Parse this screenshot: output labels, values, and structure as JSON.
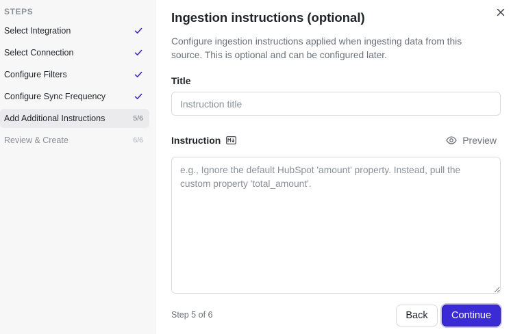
{
  "sidebar": {
    "heading": "STEPS",
    "steps": [
      {
        "label": "Select Integration",
        "status": "complete",
        "icon": "check-icon"
      },
      {
        "label": "Select Connection",
        "status": "complete",
        "icon": "check-icon"
      },
      {
        "label": "Configure Filters",
        "status": "complete",
        "icon": "check-icon"
      },
      {
        "label": "Configure Sync Frequency",
        "status": "complete",
        "icon": "check-icon"
      },
      {
        "label": "Add Additional Instructions",
        "status": "active",
        "count": "5/6"
      },
      {
        "label": "Review & Create",
        "status": "pending",
        "count": "6/6"
      }
    ]
  },
  "main": {
    "title": "Ingestion instructions (optional)",
    "description": "Configure ingestion instructions applied when ingesting data from this source. This is optional and can be configured later.",
    "title_field": {
      "label": "Title",
      "value": "",
      "placeholder": "Instruction title"
    },
    "instruction_field": {
      "label": "Instruction",
      "markdown_icon": "markdown-icon",
      "preview_label": "Preview",
      "value": "",
      "placeholder": "e.g., Ignore the default HubSpot 'amount' property. Instead, pull the custom property 'total_amount'."
    }
  },
  "footer": {
    "step_text": "Step 5 of 6",
    "back_label": "Back",
    "continue_label": "Continue"
  },
  "colors": {
    "accent": "#3b2bd4",
    "check": "#3b2bd4",
    "sidebar_bg": "#f7f7f8",
    "active_step_bg": "#ebebed"
  }
}
